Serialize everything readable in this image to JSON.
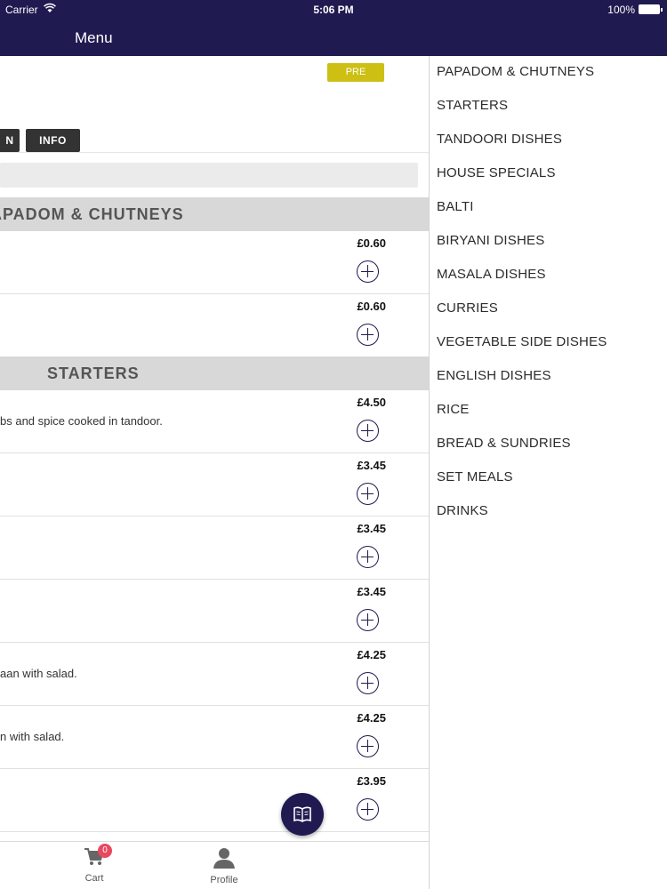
{
  "status": {
    "carrier": "Carrier",
    "time": "5:06 PM",
    "battery": "100%"
  },
  "nav": {
    "title": "Menu"
  },
  "restaurant": {
    "preorder_label": "PRE ORDER",
    "tabs": [
      "N",
      "INFO"
    ]
  },
  "sections": [
    {
      "title": "APADOM & CHUTNEYS"
    },
    {
      "title": "STARTERS"
    }
  ],
  "items": [
    {
      "price": "£0.60",
      "desc": ""
    },
    {
      "price": "£0.60",
      "desc": ""
    },
    {
      "price": "£4.50",
      "desc": "bs and spice cooked in tandoor."
    },
    {
      "price": "£3.45",
      "desc": ""
    },
    {
      "price": "£3.45",
      "desc": ""
    },
    {
      "price": "£3.45",
      "desc": ""
    },
    {
      "price": "£4.25",
      "desc": "aan with salad."
    },
    {
      "price": "£4.25",
      "desc": "n with salad."
    },
    {
      "price": "£3.95",
      "desc": ""
    }
  ],
  "tabbar": {
    "cart_label": "Cart",
    "cart_count": "0",
    "profile_label": "Profile"
  },
  "categories": [
    "PAPADOM & CHUTNEYS",
    "STARTERS",
    "TANDOORI DISHES",
    "HOUSE SPECIALS",
    "BALTI",
    "BIRYANI DISHES",
    "MASALA DISHES",
    "CURRIES",
    "VEGETABLE SIDE DISHES",
    "ENGLISH DISHES",
    "RICE",
    "BREAD & SUNDRIES",
    "SET MEALS",
    "DRINKS"
  ],
  "colors": {
    "brand": "#1f1a50",
    "preorder": "#cdbf14",
    "badge": "#e8485f",
    "section_bg": "#d8d8d8"
  },
  "icons": {
    "fab": "menu-book-icon",
    "cart": "cart-icon",
    "profile": "person-icon",
    "add": "plus-circle-icon"
  }
}
